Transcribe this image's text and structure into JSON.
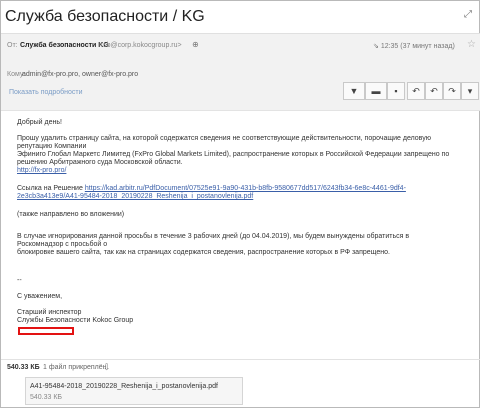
{
  "subject": "Служба безопасности / KG",
  "header": {
    "from_label": "От:",
    "from_name": "Служба безопасности KG",
    "from_address": "<sb@corp.kokocgroup.ru>",
    "time": "12:35 (37 минут назад)",
    "to_label": "Кому:",
    "to_addresses": "admin@fx-pro.pro, owner@fx-pro.pro",
    "details_link": "Показать подробности"
  },
  "toolbar": {
    "filter_icon": "filter-icon",
    "folder_icon": "folder-icon",
    "trash_icon": "trash-icon",
    "reply_icon": "reply-icon",
    "reply_all_icon": "reply-all-icon",
    "forward_icon": "forward-icon",
    "more_icon": "more-icon"
  },
  "body": {
    "greeting": "Добрый день!",
    "paragraph1_line1": "Прошу удалить страницу сайта, на которой содержатся сведения не соответствующие действительности, порочащие деловую репутацию Компании",
    "paragraph1_line2": "Эфиниго Глобал Маркетс Лимитед (FxPro Global Markets Limited), распространение которых в Российской Федерации запрещено по",
    "paragraph1_line3": "решению Арбитражного суда Московской области.",
    "site_link": "http://fx-pro.pro/",
    "decision_label": "Ссылка на Решение",
    "decision_link_line1": "https://kad.arbitr.ru/PdfDocument/07525e91-9a90-431b-b8fb-9580677dd517/6243fb34-6e8c-4461-9df4-",
    "decision_link_line2": "2e3cb3a413e9/A41-95484-2018_20190228_Reshenija_i_postanovlenija.pdf",
    "attachment_note": "(также направлено во вложении)",
    "paragraph2_line1": "В случае игнорирования данной просьбы в течение 3 рабочих дней (до 04.04.2019), мы будем вынуждены обратиться в Роскомнадзор с просьбой о",
    "paragraph2_line2": "блокировке вашего сайта, так как на страницах содержатся сведения, распространение которых в РФ запрещено.",
    "dashes": "--",
    "regards": "С уважением,",
    "signature_line1": "Старший инспектор",
    "signature_line2": "Службы Безопасности Kokoc Group"
  },
  "attachments": {
    "total_size": "540.33 КБ",
    "info": "1 файл прикреплён",
    "file_name": "A41-95484-2018_20190228_Reshenija_i_postanovlenija.pdf",
    "file_size": "540.33 КБ"
  },
  "colors": {
    "link": "#3a5fa8",
    "redaction_box": "#e31212",
    "header_bg": "#f2f2f2"
  }
}
